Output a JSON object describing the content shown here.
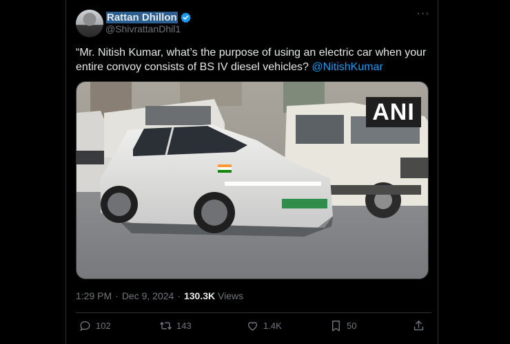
{
  "tweet": {
    "author_name": "Rattan Dhillon",
    "handle": "@ShivrattanDhil1",
    "more_label": "···",
    "text_main": "“Mr. Nitish Kumar, what’s the purpose of using an electric car when your entire convoy consists of BS IV diesel vehicles?",
    "mention": "@NitishKumar",
    "media": {
      "watermark": "ANI"
    },
    "time": "1:29 PM",
    "sep": "·",
    "date": "Dec 9, 2024",
    "sep2": "·",
    "views_count": "130.3K",
    "views_label": "Views"
  },
  "actions": {
    "replies": "102",
    "reposts": "143",
    "likes": "1.4K",
    "bookmarks": "50"
  },
  "colors": {
    "accent": "#1d9bf0",
    "muted": "#71767b",
    "background": "#000000"
  }
}
